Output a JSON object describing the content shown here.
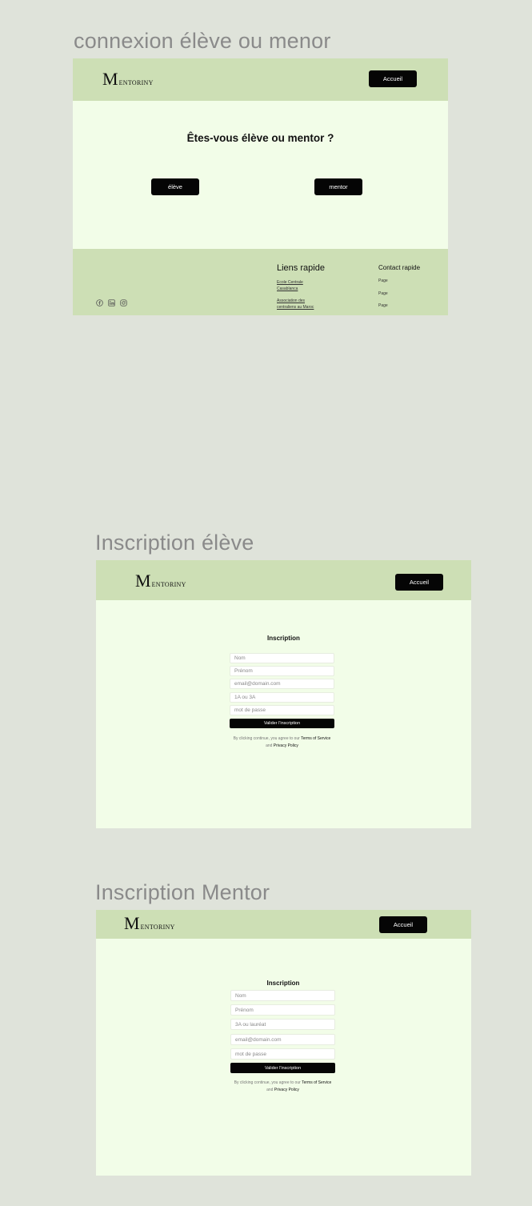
{
  "frames": [
    {
      "title": "connexion élève ou menor",
      "logo": {
        "initial": "M",
        "rest": "ENTORINY"
      },
      "nav_button": "Accueil",
      "question": "Êtes-vous élève ou mentor ?",
      "choices": [
        "élève",
        "mentor"
      ],
      "footer": {
        "social_icons": [
          "facebook-icon",
          "linkedin-icon",
          "instagram-icon"
        ],
        "quick_links_title": "Liens rapide",
        "quick_links": [
          "Ecole Centrale Casablanca",
          "Association des centraliens au Maroc"
        ],
        "contact_title": "Contact rapide",
        "contact_items": [
          "Page",
          "Page",
          "Page"
        ]
      }
    },
    {
      "title": "Inscription élève",
      "logo": {
        "initial": "M",
        "rest": "ENTORINY"
      },
      "nav_button": "Accueil",
      "form_title": "Inscription",
      "fields": [
        "Nom",
        "Prénom",
        "email@domain.com",
        "1A ou 3A",
        "mot de passe"
      ],
      "submit": "Valider l'inscription",
      "terms": {
        "prefix": "By clicking continue, you agree to our",
        "tos": "Terms of Service",
        "and": "and",
        "privacy": "Privacy Policy"
      }
    },
    {
      "title": "Inscription Mentor",
      "logo": {
        "initial": "M",
        "rest": "ENTORINY"
      },
      "nav_button": "Accueil",
      "form_title": "Inscription",
      "fields": [
        "Nom",
        "Prénom",
        "3A ou lauréat",
        "email@domain.com",
        "mot de passe"
      ],
      "submit": "Valider l'inscription",
      "terms": {
        "prefix": "By clicking continue, you agree to our",
        "tos": "Terms of Service",
        "and": "and",
        "privacy": "Privacy Policy"
      }
    }
  ]
}
